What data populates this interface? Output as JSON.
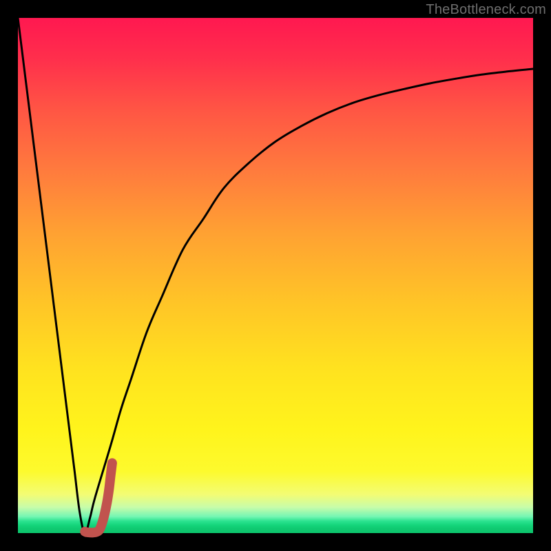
{
  "watermark": "TheBottleneck.com",
  "colors": {
    "frame": "#000000",
    "curve": "#000000",
    "marker": "#c1534e",
    "gradient_top": "#ff1850",
    "gradient_mid": "#ffe21f",
    "gradient_bottom": "#0cc46c"
  },
  "chart_data": {
    "type": "line",
    "title": "",
    "xlabel": "",
    "ylabel": "",
    "xlim": [
      0,
      100
    ],
    "ylim": [
      0,
      100
    ],
    "grid": false,
    "legend": false,
    "series": [
      {
        "name": "bottleneck-curve",
        "x": [
          0,
          1,
          2,
          3,
          4,
          5,
          6,
          7,
          8,
          9,
          10,
          11,
          12,
          13,
          14,
          15,
          18,
          20,
          22,
          25,
          28,
          32,
          36,
          40,
          45,
          50,
          55,
          60,
          65,
          70,
          75,
          80,
          85,
          90,
          95,
          100
        ],
        "values": [
          100,
          92,
          84,
          76,
          68,
          60,
          52,
          44,
          36,
          28,
          20,
          12,
          4,
          0,
          3,
          7,
          17,
          24,
          30,
          39,
          46,
          55,
          61,
          67,
          72,
          76,
          79,
          81.5,
          83.5,
          85,
          86.2,
          87.3,
          88.2,
          89,
          89.6,
          90.1
        ]
      },
      {
        "name": "ideal-marker",
        "x": [
          13.0,
          13.2,
          13.5,
          14.0,
          14.6,
          15.2,
          15.8,
          16.3,
          16.8,
          17.3,
          17.7,
          18.0,
          18.3
        ],
        "values": [
          0.3,
          0.2,
          0.15,
          0.1,
          0.1,
          0.2,
          0.6,
          1.8,
          3.6,
          6.0,
          8.6,
          11.2,
          13.6
        ]
      }
    ]
  }
}
